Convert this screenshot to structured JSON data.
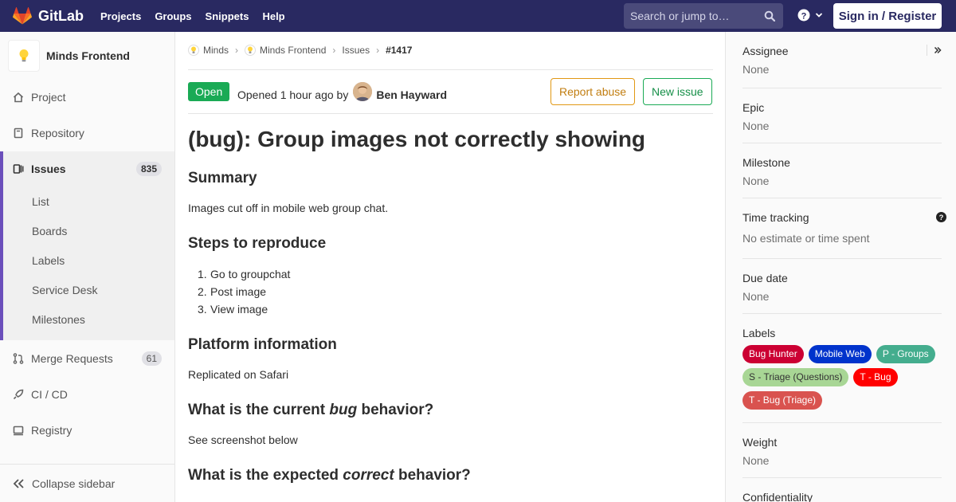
{
  "topbar": {
    "brand": "GitLab",
    "nav": [
      "Projects",
      "Groups",
      "Snippets",
      "Help"
    ],
    "search_placeholder": "Search or jump to…",
    "signin": "Sign in / Register"
  },
  "sidebar": {
    "project_name": "Minds Frontend",
    "items": [
      {
        "label": "Project",
        "icon": "home-icon"
      },
      {
        "label": "Repository",
        "icon": "book-icon"
      },
      {
        "label": "Issues",
        "icon": "issues-icon",
        "count": "835"
      },
      {
        "label": "Merge Requests",
        "icon": "merge-request-icon",
        "count": "61"
      },
      {
        "label": "CI / CD",
        "icon": "rocket-icon"
      },
      {
        "label": "Registry",
        "icon": "container-icon"
      }
    ],
    "issue_sub": [
      "List",
      "Boards",
      "Labels",
      "Service Desk",
      "Milestones"
    ],
    "collapse": "Collapse sidebar"
  },
  "breadcrumb": [
    "Minds",
    "Minds Frontend",
    "Issues",
    "#1417"
  ],
  "issue": {
    "status": "Open",
    "opened_text": "Opened 1 hour ago by",
    "author": "Ben Hayward",
    "report_abuse": "Report abuse",
    "new_issue": "New issue",
    "title": "(bug): Group images not correctly showing",
    "summary_heading": "Summary",
    "summary_text": "Images cut off in mobile web group chat.",
    "steps_heading": "Steps to reproduce",
    "steps": [
      "Go to groupchat",
      "Post image",
      "View image"
    ],
    "platform_heading": "Platform information",
    "platform_text": "Replicated on Safari",
    "current_heading_pre": "What is the current ",
    "current_heading_em": "bug",
    "current_heading_post": " behavior?",
    "current_text": "See screenshot below",
    "expected_heading_pre": "What is the expected ",
    "expected_heading_em": "correct",
    "expected_heading_post": " behavior?"
  },
  "rsidebar": {
    "assignee_label": "Assignee",
    "assignee_value": "None",
    "epic_label": "Epic",
    "epic_value": "None",
    "milestone_label": "Milestone",
    "milestone_value": "None",
    "time_label": "Time tracking",
    "time_value": "No estimate or time spent",
    "due_label": "Due date",
    "due_value": "None",
    "labels_label": "Labels",
    "labels": [
      {
        "text": "Bug Hunter",
        "color": "#cc0033"
      },
      {
        "text": "Mobile Web",
        "color": "#0033cc"
      },
      {
        "text": "P - Groups",
        "color": "#44ad8e"
      },
      {
        "text": "S - Triage (Questions)",
        "color": "#a8d695"
      },
      {
        "text": "T - Bug",
        "color": "#ff0000"
      },
      {
        "text": "T - Bug (Triage)",
        "color": "#d9534f"
      }
    ],
    "weight_label": "Weight",
    "weight_value": "None",
    "confidentiality_label": "Confidentiality"
  }
}
